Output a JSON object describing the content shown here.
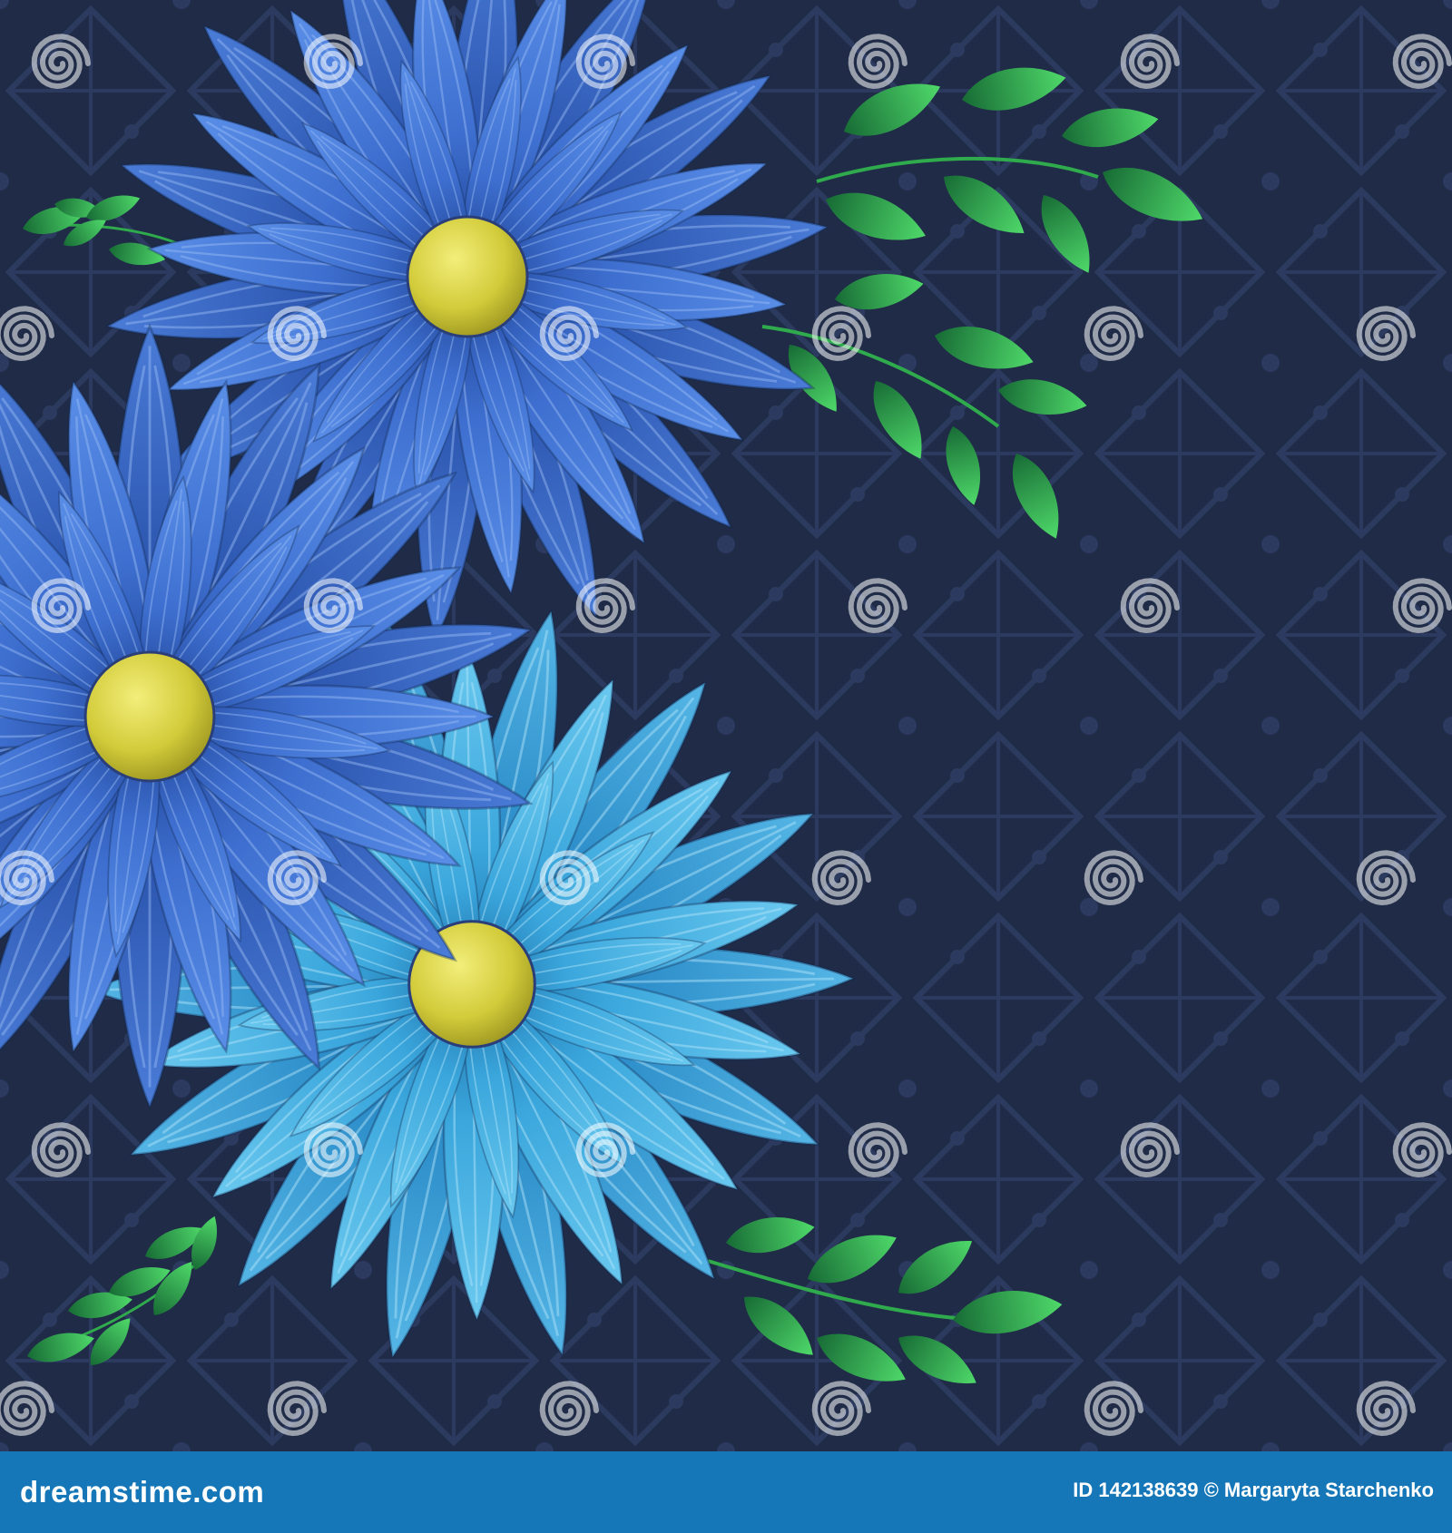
{
  "image": {
    "background_color": "#1f2b47",
    "pattern_color": "#2b3a5e",
    "flowers": [
      {
        "name": "blue-flower-top",
        "palette": "royal-blue",
        "center_color": "#d6cf3f"
      },
      {
        "name": "blue-flower-left",
        "palette": "royal-blue",
        "center_color": "#d6cf3f"
      },
      {
        "name": "light-blue-flower-bottom",
        "palette": "sky-blue",
        "center_color": "#d6cf3f"
      }
    ],
    "leaf_color": "#2faa4c",
    "watermark_icon": "spiral-icon",
    "watermark_text": "dreamstime"
  },
  "footer": {
    "brand": "dreamstime.com",
    "credit_line": "ID 142138639 © Margaryta Starchenko",
    "background_color": "#1677b8"
  }
}
